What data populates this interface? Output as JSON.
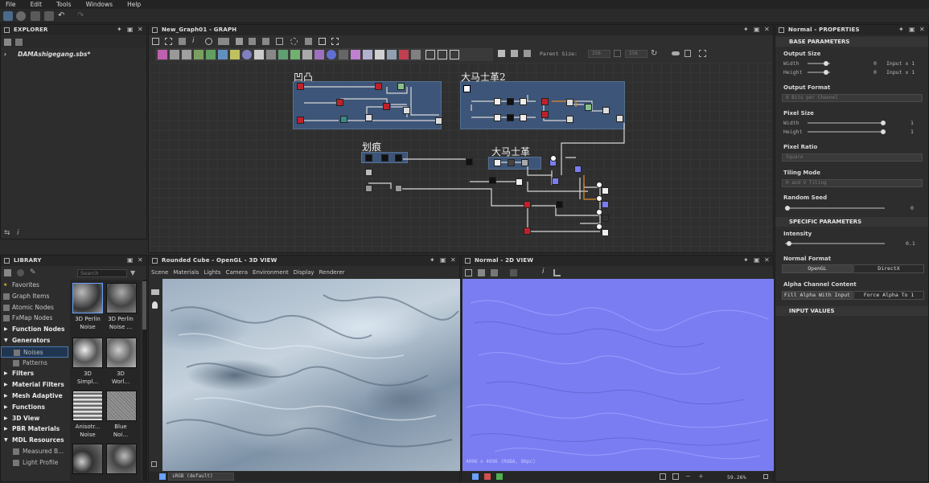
{
  "menu": [
    "File",
    "Edit",
    "Tools",
    "Windows",
    "Help"
  ],
  "explorer": {
    "title": "EXPLORER",
    "file": "DAMAshigegang.sbs*"
  },
  "graph": {
    "title": "New_Graph01 - GRAPH",
    "parent_size_label": "Parent Size:",
    "parent_size_value": "256",
    "size2": "256",
    "frames": [
      {
        "label": "凹凸"
      },
      {
        "label": "大马士革2"
      },
      {
        "label": "划痕"
      },
      {
        "label": "大马士革"
      }
    ]
  },
  "library": {
    "title": "LIBRARY",
    "search_placeholder": "Search",
    "tree": [
      {
        "label": "Favorites",
        "kind": "star"
      },
      {
        "label": "Graph Items",
        "kind": "item"
      },
      {
        "label": "Atomic Nodes",
        "kind": "item"
      },
      {
        "label": "FxMap Nodes",
        "kind": "item"
      },
      {
        "label": "Function Nodes",
        "kind": "group"
      },
      {
        "label": "Generators",
        "kind": "open"
      },
      {
        "label": "Noises",
        "kind": "sub-selected"
      },
      {
        "label": "Patterns",
        "kind": "sub"
      },
      {
        "label": "Filters",
        "kind": "group"
      },
      {
        "label": "Material Filters",
        "kind": "group"
      },
      {
        "label": "Mesh Adaptive",
        "kind": "group"
      },
      {
        "label": "Functions",
        "kind": "group"
      },
      {
        "label": "3D View",
        "kind": "group"
      },
      {
        "label": "PBR Materials",
        "kind": "group"
      },
      {
        "label": "MDL Resources",
        "kind": "open"
      },
      {
        "label": "Measured B...",
        "kind": "sub"
      },
      {
        "label": "Light Profile",
        "kind": "sub"
      }
    ],
    "thumbs": [
      {
        "line1": "3D Perlin",
        "line2": "Noise"
      },
      {
        "line1": "3D Perlin",
        "line2": "Noise ..."
      },
      {
        "line1": "3D",
        "line2": "Simpl..."
      },
      {
        "line1": "3D",
        "line2": "Worl..."
      },
      {
        "line1": "Anisotr...",
        "line2": "Noise"
      },
      {
        "line1": "Blue",
        "line2": "Noi..."
      }
    ]
  },
  "view3d": {
    "title": "Rounded Cube - OpenGL - 3D VIEW",
    "menu": [
      "Scene",
      "Materials",
      "Lights",
      "Camera",
      "Environment",
      "Display",
      "Renderer"
    ],
    "colorspace": "sRGB (default)"
  },
  "view2d": {
    "title": "Normal - 2D VIEW",
    "info": "4096 x 4096 (RGBA, 8bpc)",
    "zoom": "59.26%",
    "color": "#7a7df2"
  },
  "properties": {
    "title": "Normal - PROPERTIES",
    "base_section": "BASE PARAMETERS",
    "output_size": {
      "label": "Output Size",
      "width_label": "Width",
      "height_label": "Height",
      "width_val": "0",
      "height_val": "0",
      "width_mode": "Input x 1",
      "height_mode": "Input x 1"
    },
    "output_format": {
      "label": "Output Format",
      "value": "8 Bits per Channel"
    },
    "pixel_size": {
      "label": "Pixel Size",
      "width_label": "Width",
      "height_label": "Height",
      "width_val": "1",
      "height_val": "1"
    },
    "pixel_ratio": {
      "label": "Pixel Ratio",
      "value": "Square"
    },
    "tiling_mode": {
      "label": "Tiling Mode",
      "value": "H and V Tiling"
    },
    "random_seed": {
      "label": "Random Seed",
      "value": "0"
    },
    "specific_section": "SPECIFIC PARAMETERS",
    "intensity": {
      "label": "Intensity",
      "value": "0.1"
    },
    "normal_format": {
      "label": "Normal Format",
      "opt1": "OpenGL",
      "opt2": "DirectX"
    },
    "alpha": {
      "label": "Alpha Channel Content",
      "opt1": "Fill Alpha With Input",
      "opt2": "Force Alpha To 1"
    },
    "input_section": "INPUT VALUES"
  }
}
